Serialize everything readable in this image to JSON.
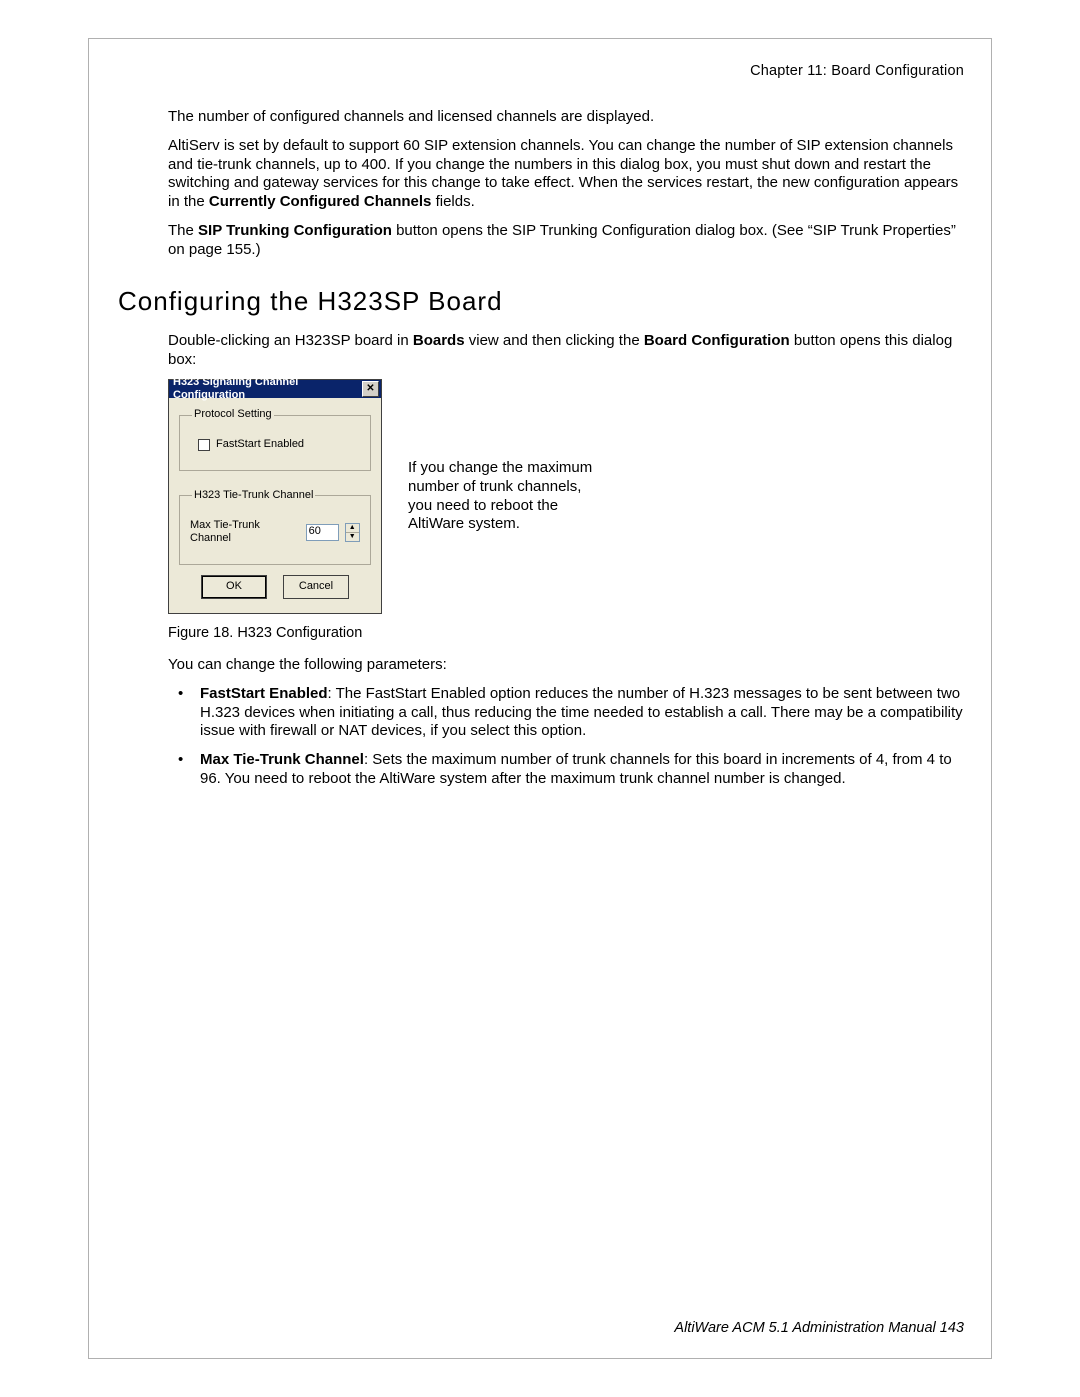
{
  "header": {
    "running_head": "Chapter 11:  Board Configuration"
  },
  "intro": {
    "p1": "The number of configured channels and licensed channels are displayed.",
    "p2_a": "AltiServ is set by default to support 60 SIP extension channels. You can change the number of SIP extension channels and tie-trunk channels, up to 400. If you change the numbers in this dialog box, you must shut down and restart the switching and gateway services for this change to take effect. When the services restart, the new configuration appears in the ",
    "p2_b": "Currently Configured Channels",
    "p2_c": " fields.",
    "p3_a": "The ",
    "p3_b": "SIP Trunking Configuration",
    "p3_c": " button opens the SIP Trunking Configuration dialog box. (See “SIP Trunk Properties” on page 155.)"
  },
  "section": {
    "title": "Configuring the H323SP Board",
    "p1_a": "Double-clicking an H323SP board in ",
    "p1_b": "Boards",
    "p1_c": " view and then clicking the ",
    "p1_d": "Board Configuration",
    "p1_e": " button opens this dialog box:"
  },
  "dialog": {
    "title": "H323 Signaling Channel Configuration",
    "group_protocol": "Protocol Setting",
    "faststart_label": "FastStart Enabled",
    "group_tie": "H323 Tie-Trunk Channel",
    "max_tie_label": "Max Tie-Trunk Channel",
    "max_tie_value": "60",
    "ok": "OK",
    "cancel": "Cancel"
  },
  "side_note": "If you change the maximum number of trunk channels, you need to reboot the AltiWare system.",
  "caption": "Figure 18.   H323 Configuration",
  "after": {
    "p1": "You can change the following parameters:",
    "bullet1_b": "FastStart Enabled",
    "bullet1_t": ": The FastStart Enabled option reduces the number of H.323 messages to be sent between two H.323 devices when initiating a call, thus reducing the time needed to establish a call. There may be a compatibility issue with firewall or NAT devices, if you select this option.",
    "bullet2_b": "Max Tie-Trunk Channel",
    "bullet2_t": ": Sets the maximum number of trunk channels for this board in increments of 4, from 4 to 96. You need to reboot the AltiWare system after the maximum trunk channel number is changed."
  },
  "footer": {
    "text": "AltiWare ACM 5.1 Administration Manual   143"
  }
}
